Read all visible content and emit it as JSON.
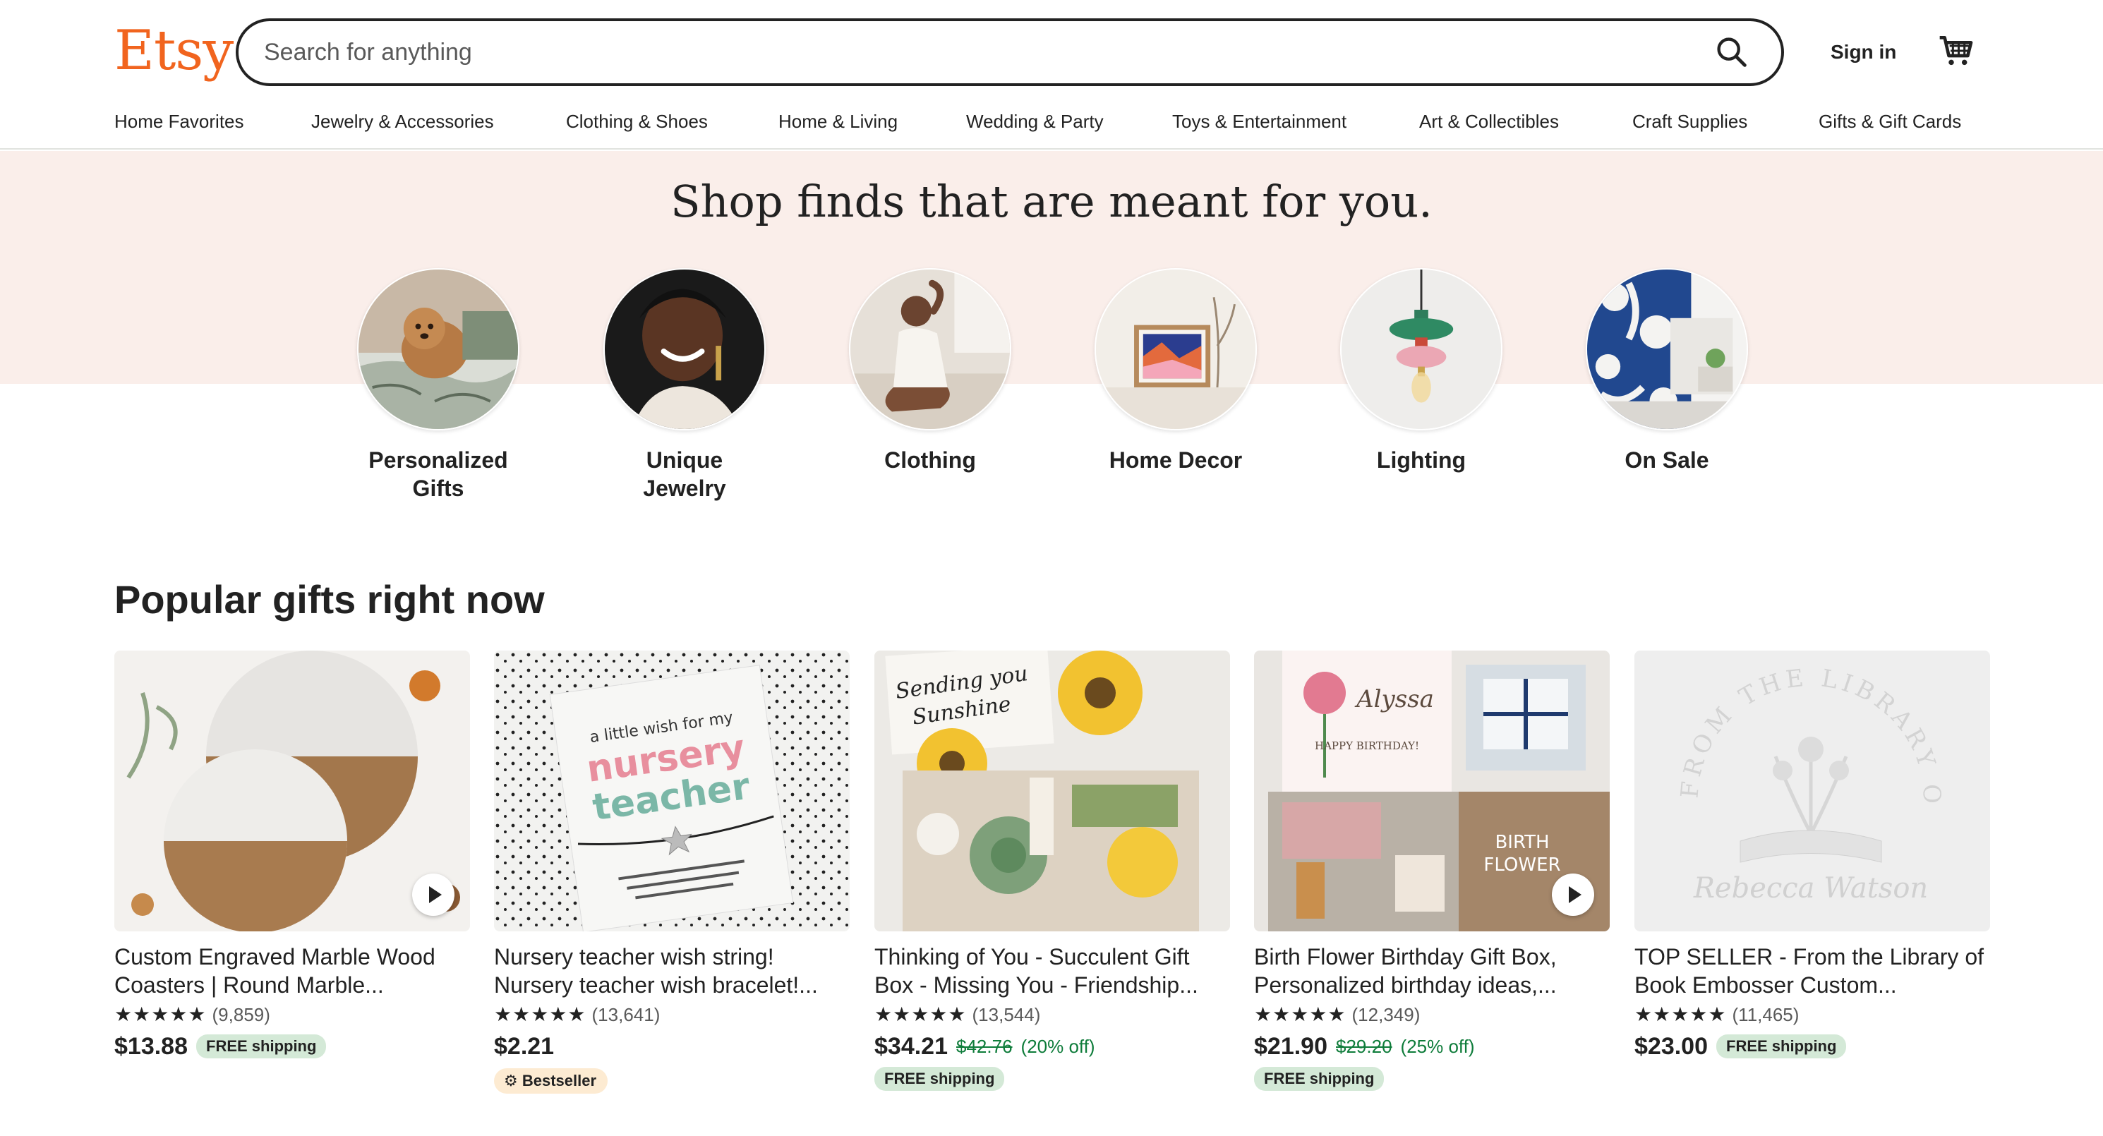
{
  "header": {
    "logo": "Etsy",
    "search_placeholder": "Search for anything",
    "sign_in": "Sign in"
  },
  "nav": [
    "Home Favorites",
    "Jewelry & Accessories",
    "Clothing & Shoes",
    "Home & Living",
    "Wedding & Party",
    "Toys & Entertainment",
    "Art & Collectibles",
    "Craft Supplies",
    "Gifts & Gift Cards"
  ],
  "banner": {
    "headline": "Shop finds that are meant for you.",
    "categories": [
      {
        "line1": "Personalized",
        "line2": "Gifts"
      },
      {
        "line1": "Unique",
        "line2": "Jewelry"
      },
      {
        "line1": "Clothing",
        "line2": ""
      },
      {
        "line1": "Home Decor",
        "line2": ""
      },
      {
        "line1": "Lighting",
        "line2": ""
      },
      {
        "line1": "On Sale",
        "line2": ""
      }
    ]
  },
  "popular": {
    "title": "Popular gifts right now",
    "items": [
      {
        "title": "Custom Engraved Marble Wood Coasters | Round Marble...",
        "stars": "★★★★★",
        "reviews": "(9,859)",
        "price": "$13.88",
        "orig_price": "",
        "discount": "",
        "shipping": "FREE shipping",
        "badge": ""
      },
      {
        "title": "Nursery teacher wish string! Nursery teacher wish bracelet!...",
        "stars": "★★★★★",
        "reviews": "(13,641)",
        "price": "$2.21",
        "orig_price": "",
        "discount": "",
        "shipping": "",
        "badge": "Bestseller"
      },
      {
        "title": "Thinking of You - Succulent Gift Box - Missing You - Friendship...",
        "stars": "★★★★★",
        "reviews": "(13,544)",
        "price": "$34.21",
        "orig_price": "$42.76",
        "discount": "(20% off)",
        "shipping": "FREE shipping",
        "badge": ""
      },
      {
        "title": "Birth Flower Birthday Gift Box, Personalized birthday ideas,...",
        "stars": "★★★★★",
        "reviews": "(12,349)",
        "price": "$21.90",
        "orig_price": "$29.20",
        "discount": "(25% off)",
        "shipping": "FREE shipping",
        "badge": ""
      },
      {
        "title": "TOP SELLER - From the Library of Book Embosser Custom...",
        "stars": "★★★★★",
        "reviews": "(11,465)",
        "price": "$23.00",
        "orig_price": "",
        "discount": "",
        "shipping": "FREE shipping",
        "badge": ""
      }
    ],
    "image_text": {
      "nursery_card": [
        "a little wish for my",
        "nursery",
        "teacher"
      ],
      "sunshine_card": [
        "Sending you",
        "Sunshine"
      ],
      "birthday_card": [
        "Alyssa",
        "HAPPY BIRTHDAY!"
      ],
      "birth_flower": [
        "BIRTH",
        "FLOWER"
      ],
      "embosser": [
        "FROM THE LIBRARY OF",
        "Rebecca Watson"
      ]
    }
  },
  "colors": {
    "brand": "#F1641E",
    "banner_bg": "#FAEEEA",
    "discount_green": "#0E7C3A",
    "shipping_pill": "#D4E9D7",
    "bestseller_pill": "#FDEBD2"
  },
  "icons": [
    "search-icon",
    "cart-icon",
    "play-icon",
    "bestseller-icon"
  ]
}
